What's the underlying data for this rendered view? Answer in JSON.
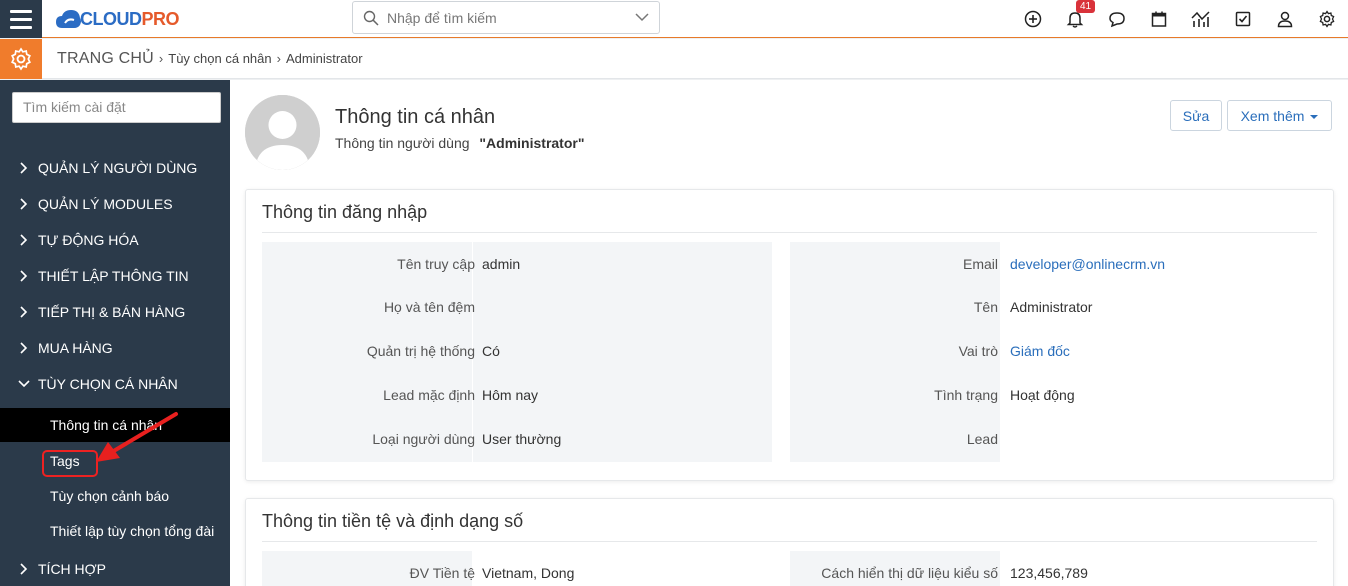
{
  "brand": {
    "logo_text": "CLOUDPRO",
    "accent": "#f07c2c",
    "sidebar_bg": "#2b3a4a"
  },
  "search": {
    "placeholder": "Nhập để tìm kiếm"
  },
  "topbar": {
    "icons": [
      "plus-circle-icon",
      "bell-icon",
      "chat-icon",
      "calendar-icon",
      "chart-icon",
      "checkbox-icon",
      "user-icon",
      "gear-icon"
    ],
    "notification_count": "41"
  },
  "breadcrumb": {
    "home": "TRANG CHỦ",
    "items": [
      "Tùy chọn cá nhân",
      "Administrator"
    ]
  },
  "sidebar": {
    "search_placeholder": "Tìm kiếm cài đặt",
    "menu": [
      "QUẢN LÝ NGƯỜI DÙNG",
      "QUẢN LÝ MODULES",
      "TỰ ĐỘNG HÓA",
      "THIẾT LẬP THÔNG TIN",
      "TIẾP THỊ & BÁN HÀNG",
      "MUA HÀNG",
      "TÙY CHỌN CÁ NHÂN"
    ],
    "submenu": [
      "Thông tin cá nhân",
      "Tags",
      "Tùy chọn cảnh báo",
      "Thiết lập tùy chọn tổng đài"
    ],
    "after": "TÍCH HỢP"
  },
  "profile": {
    "title": "Thông tin cá nhân",
    "subtitle_label": "Thông tin người dùng",
    "subtitle_value": "\"Administrator\"",
    "edit_label": "Sửa",
    "more_label": "Xem thêm"
  },
  "login_section": {
    "title": "Thông tin đăng nhập",
    "left": [
      {
        "label": "Tên truy cập",
        "value": "admin"
      },
      {
        "label": "Họ và tên đệm",
        "value": ""
      },
      {
        "label": "Quản trị hệ thống",
        "value": "Có"
      },
      {
        "label": "Lead mặc định",
        "value": "Hôm nay"
      },
      {
        "label": "Loại người dùng",
        "value": "User thường"
      }
    ],
    "right": [
      {
        "label": "Email",
        "value": "developer@onlinecrm.vn"
      },
      {
        "label": "Tên",
        "value": "Administrator"
      },
      {
        "label": "Vai trò",
        "value": "Giám đốc"
      },
      {
        "label": "Tình trạng",
        "value": "Hoạt động"
      },
      {
        "label": "Lead",
        "value": ""
      }
    ]
  },
  "currency_section": {
    "title": "Thông tin tiền tệ và định dạng số",
    "left": [
      {
        "label": "ĐV Tiền tệ",
        "value": "Vietnam, Dong"
      }
    ],
    "right": [
      {
        "label": "Cách hiển thị dữ liệu kiểu số",
        "value": "123,456,789"
      }
    ]
  }
}
